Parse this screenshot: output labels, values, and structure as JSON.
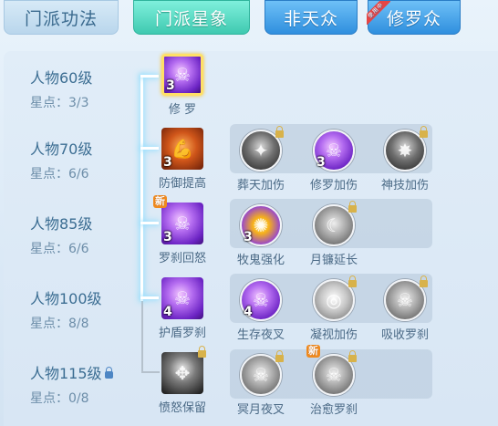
{
  "tabs": [
    {
      "label": "门派功法"
    },
    {
      "label": "门派星象"
    },
    {
      "label": "非天众"
    },
    {
      "label": "修罗众",
      "ribbon": "使用中"
    }
  ],
  "rows": [
    {
      "level": "人物60级",
      "stars": "星点：3/3"
    },
    {
      "level": "人物70级",
      "stars": "星点：6/6"
    },
    {
      "level": "人物85级",
      "stars": "星点：6/6"
    },
    {
      "level": "人物100级",
      "stars": "星点：8/8"
    },
    {
      "level": "人物115级",
      "stars": "星点：0/8"
    }
  ],
  "nodes": {
    "r1": [
      {
        "name": "修 罗",
        "count": "3"
      }
    ],
    "r2": [
      {
        "name": "防御提高",
        "count": "3"
      },
      {
        "name": "葬天加伤",
        "count": ""
      },
      {
        "name": "修罗加伤",
        "count": "3"
      },
      {
        "name": "神技加伤",
        "count": ""
      }
    ],
    "r3": [
      {
        "name": "罗刹回怒",
        "count": "3",
        "badge": "新"
      },
      {
        "name": "牧鬼强化",
        "count": "3"
      },
      {
        "name": "月镰延长",
        "count": ""
      }
    ],
    "r4": [
      {
        "name": "护盾罗刹",
        "count": "4"
      },
      {
        "name": "生存夜叉",
        "count": "4"
      },
      {
        "name": "凝视加伤",
        "count": ""
      },
      {
        "name": "吸收罗刹",
        "count": ""
      }
    ],
    "r5": [
      {
        "name": "愤怒保留",
        "count": ""
      },
      {
        "name": "冥月夜叉",
        "count": ""
      },
      {
        "name": "治愈罗刹",
        "count": "",
        "badge": "新"
      }
    ]
  },
  "colors": {
    "active_tab": "#3fc9b0",
    "blue_tab": "#2f8fde",
    "glow_line": "#ffffff"
  }
}
